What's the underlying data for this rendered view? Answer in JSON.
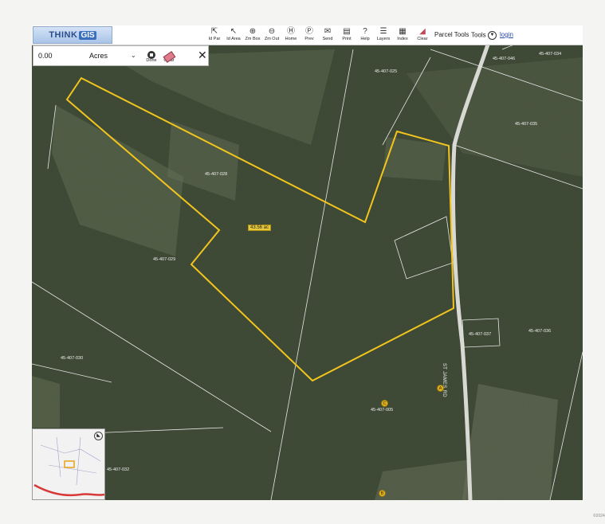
{
  "logo": {
    "think": "THINK",
    "gis": "GIS"
  },
  "toolbar": {
    "tools": [
      {
        "name": "id-par",
        "label": "Id Par",
        "icon": "pointer-icon"
      },
      {
        "name": "id-area",
        "label": "Id Area",
        "icon": "lasso-icon"
      },
      {
        "name": "zoom-box",
        "label": "Zm Box",
        "icon": "zoom-in-icon"
      },
      {
        "name": "zoom-out",
        "label": "Zm Out",
        "icon": "zoom-out-icon"
      },
      {
        "name": "home",
        "label": "Home",
        "icon": "home-icon"
      },
      {
        "name": "prev",
        "label": "Prev",
        "icon": "previous-view-icon"
      },
      {
        "name": "send",
        "label": "Send",
        "icon": "envelope-icon"
      },
      {
        "name": "print",
        "label": "Print",
        "icon": "printer-icon"
      },
      {
        "name": "help",
        "label": "Help",
        "icon": "help-icon"
      },
      {
        "name": "layers",
        "label": "Layers",
        "icon": "layers-icon"
      },
      {
        "name": "index",
        "label": "Index",
        "icon": "index-icon"
      },
      {
        "name": "clear",
        "label": "Clear",
        "icon": "eraser-icon"
      }
    ],
    "parcel_tools": "Parcel Tools",
    "tools_menu": "Tools",
    "login": "login"
  },
  "measure": {
    "value": "0.00",
    "unit": "Acres",
    "done": "Done",
    "clear": "Clear"
  },
  "map": {
    "acreage": "43.56 ac",
    "road": "ST JAMES RD",
    "parcels": [
      "45-407-046",
      "45-407-034",
      "45-407-025",
      "45-407-035",
      "45-407-028",
      "45-407-029",
      "45-407-037",
      "45-407-036",
      "45-407-030",
      "45-407-005",
      "45-407-032"
    ],
    "markers": [
      "A",
      "C",
      "B"
    ],
    "colors": {
      "boundary": "#f2c51d",
      "parcel_line": "#e6e6e6",
      "road": "#d9d9d4"
    }
  },
  "corner_mark": "©2024"
}
